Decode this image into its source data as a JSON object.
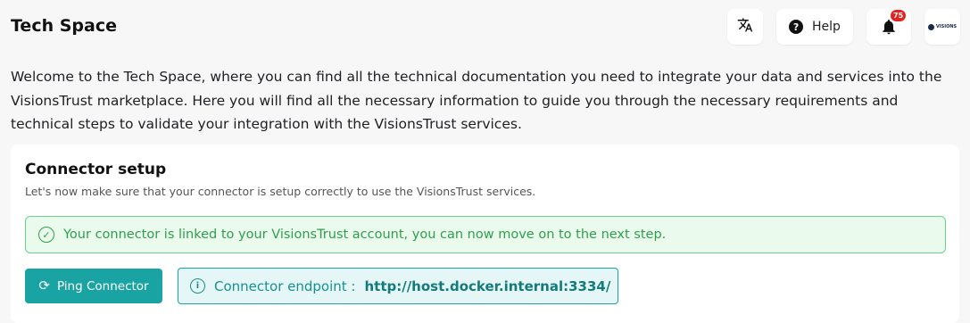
{
  "header": {
    "title": "Tech Space",
    "help_label": "Help",
    "notification_count": "75",
    "logo_text": "VISIONS"
  },
  "intro": {
    "text": "Welcome to the Tech Space, where you can find all the technical documentation you need to integrate your data and services into the VisionsTrust marketplace. Here you will find all the necessary information to guide you through the necessary requirements and technical steps to validate your integration with the VisionsTrust services."
  },
  "connector": {
    "title": "Connector setup",
    "subtitle": "Let's now make sure that your connector is setup correctly to use the VisionsTrust services.",
    "success_message": "Your connector is linked to your VisionsTrust account, you can now move on to the next step.",
    "ping_button_label": "Ping Connector",
    "endpoint_label": "Connector endpoint :",
    "endpoint_url": "http://host.docker.internal:3334/"
  },
  "colors": {
    "accent": "#1aa3a3",
    "success": "#2f9e4c",
    "badge": "#e02424"
  },
  "icons": [
    "translate-icon",
    "help-icon",
    "bell-icon",
    "check-circle-icon",
    "refresh-icon",
    "info-icon"
  ]
}
